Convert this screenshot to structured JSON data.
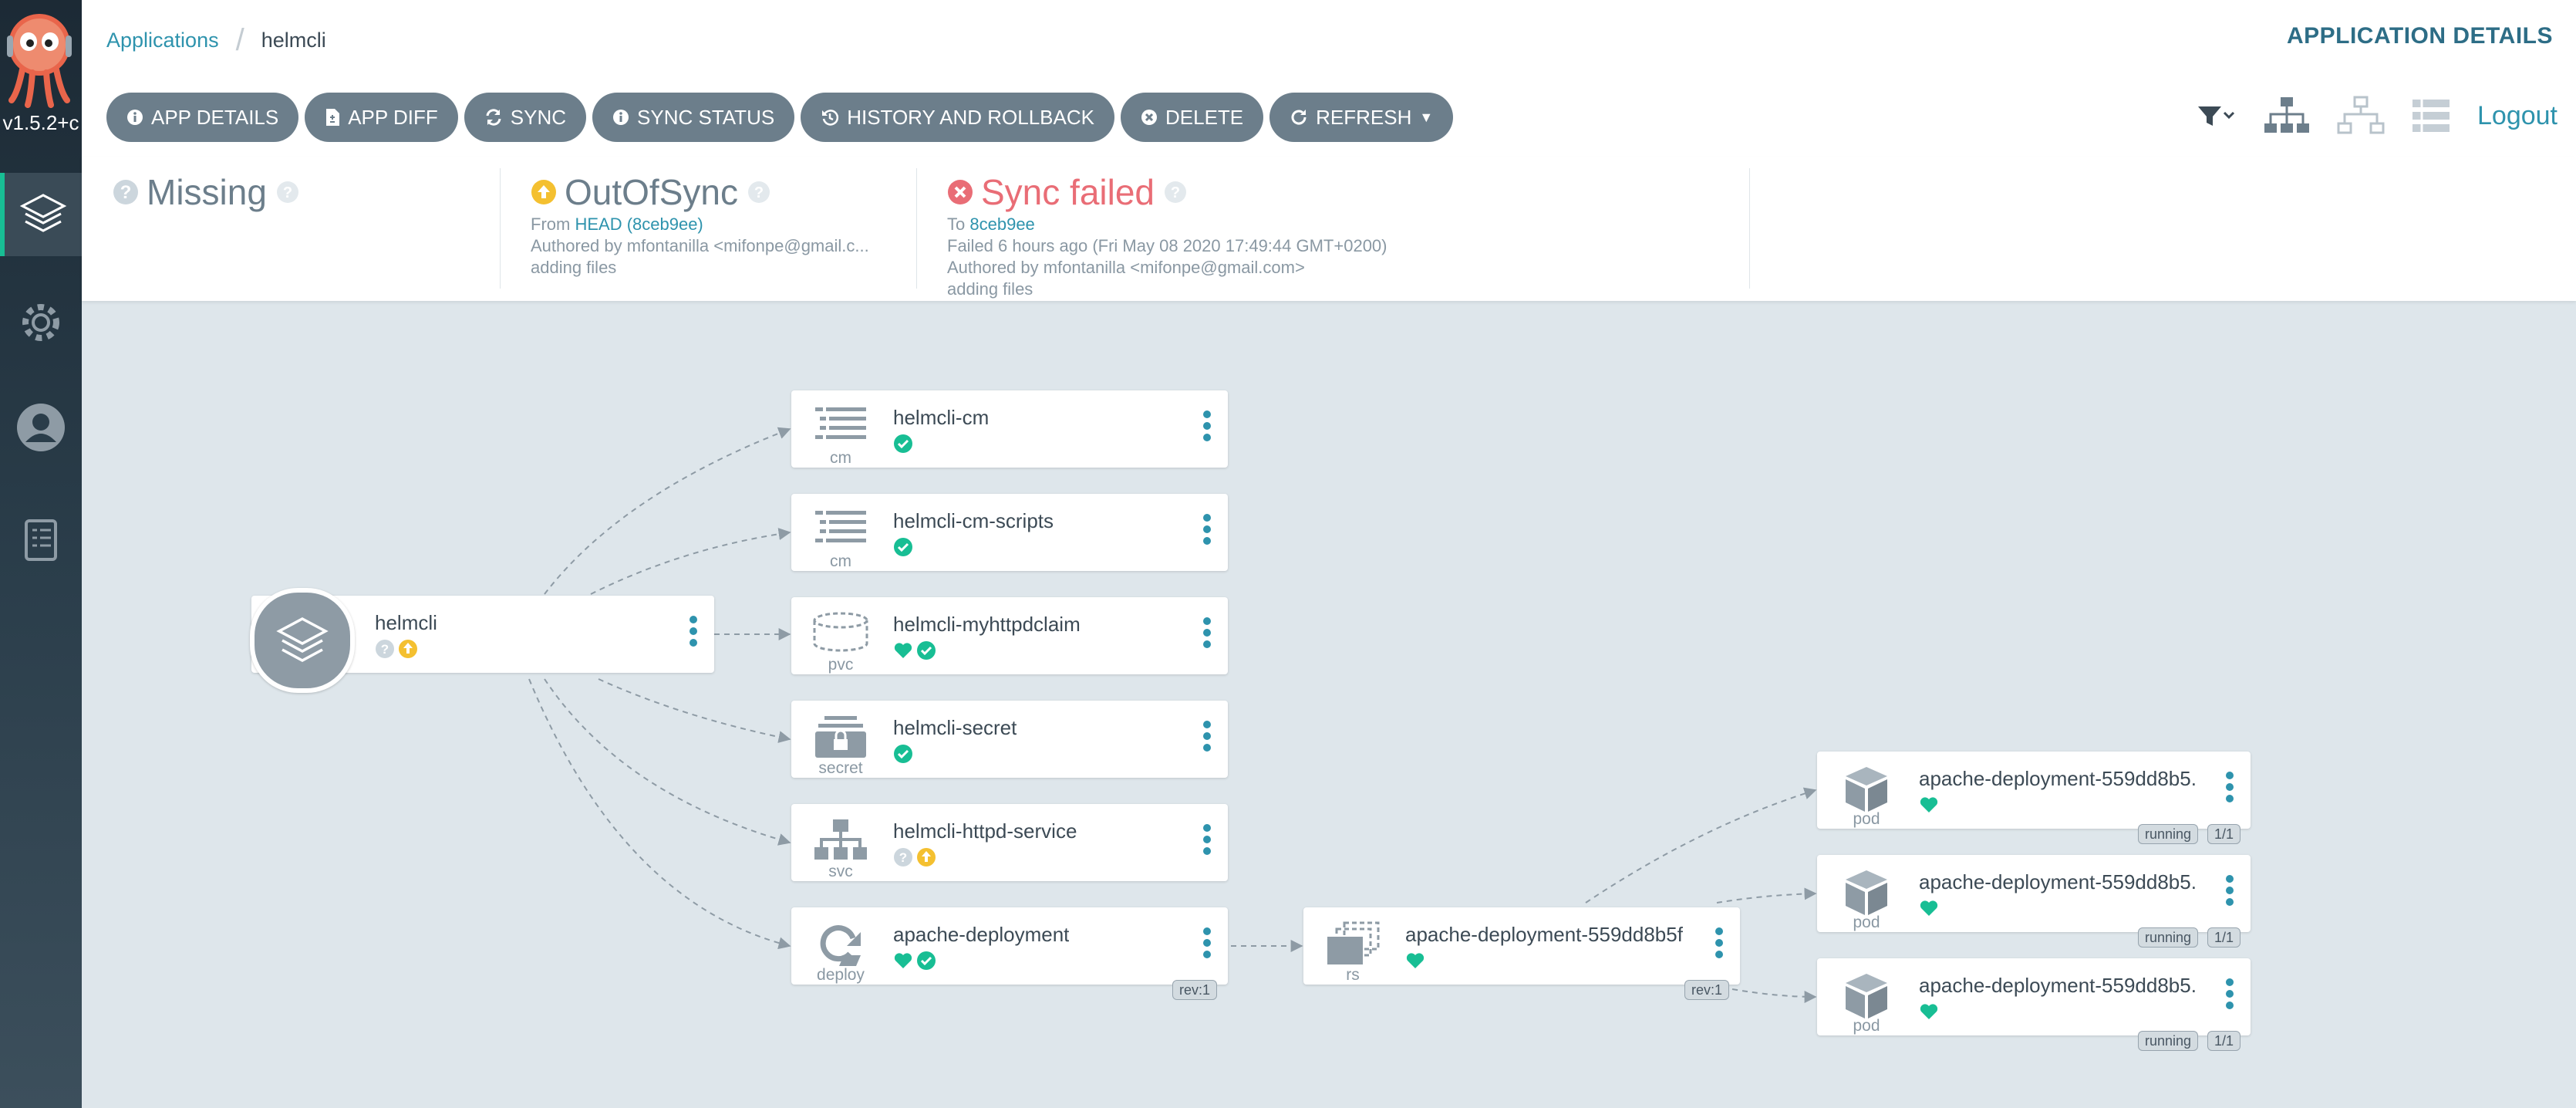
{
  "sidebar": {
    "version": "v1.5.2+c",
    "items": [
      "applications",
      "settings",
      "user-info",
      "documentation"
    ]
  },
  "breadcrumb": {
    "parent": "Applications",
    "current": "helmcli"
  },
  "page_title": "APPLICATION DETAILS",
  "toolbar": {
    "app_details": "APP DETAILS",
    "app_diff": "APP DIFF",
    "sync": "SYNC",
    "sync_status": "SYNC STATUS",
    "history": "HISTORY AND ROLLBACK",
    "delete": "DELETE",
    "refresh": "REFRESH",
    "logout": "Logout"
  },
  "status": {
    "health": {
      "label": "Missing"
    },
    "sync": {
      "label": "OutOfSync",
      "from_prefix": "From",
      "revision": "HEAD (8ceb9ee)",
      "author": "Authored by mfontanilla <mifonpe@gmail.c...",
      "message": "adding files"
    },
    "operation": {
      "label": "Sync failed",
      "to_prefix": "To",
      "revision": "8ceb9ee",
      "time": "Failed 6 hours ago (Fri May 08 2020 17:49:44 GMT+0200)",
      "author": "Authored by mfontanilla <mifonpe@gmail.com>",
      "message": "adding files"
    }
  },
  "colors": {
    "accent": "#2e93ad",
    "healthy": "#18be94",
    "outofsync": "#f4c030",
    "failed": "#e96d76",
    "unknown": "#ccd6dd"
  },
  "graph": {
    "app": {
      "name": "helmcli"
    },
    "resources": [
      {
        "name": "helmcli-cm",
        "kind": "cm"
      },
      {
        "name": "helmcli-cm-scripts",
        "kind": "cm"
      },
      {
        "name": "helmcli-myhttpdclaim",
        "kind": "pvc"
      },
      {
        "name": "helmcli-secret",
        "kind": "secret"
      },
      {
        "name": "helmcli-httpd-service",
        "kind": "svc"
      },
      {
        "name": "apache-deployment",
        "kind": "deploy",
        "tag": "rev:1"
      }
    ],
    "replicaset": {
      "name": "apache-deployment-559dd8b5f",
      "kind": "rs",
      "tag": "rev:1"
    },
    "pods": [
      {
        "name": "apache-deployment-559dd8b5...",
        "kind": "pod",
        "status": "running",
        "ready": "1/1"
      },
      {
        "name": "apache-deployment-559dd8b5...",
        "kind": "pod",
        "status": "running",
        "ready": "1/1"
      },
      {
        "name": "apache-deployment-559dd8b5...",
        "kind": "pod",
        "status": "running",
        "ready": "1/1"
      }
    ]
  }
}
